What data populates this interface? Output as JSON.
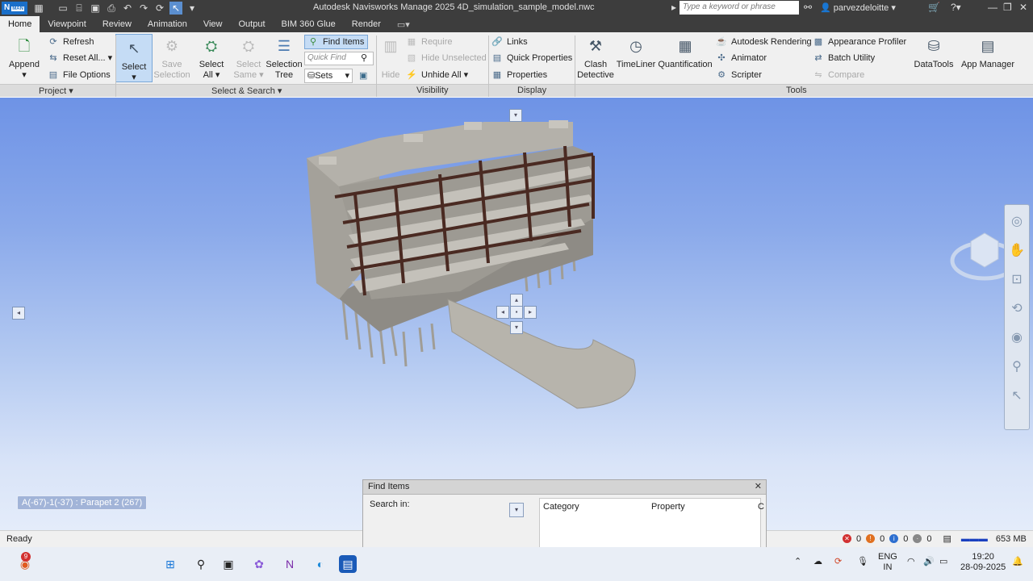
{
  "titlebar": {
    "logo": "N",
    "logo_sub": "MAN",
    "app_title": "Autodesk Navisworks Manage 2025     4D_simulation_sample_model.nwc",
    "search_placeholder": "Type a keyword or phrase",
    "user": "parvezdeloitte"
  },
  "tabs": [
    "Home",
    "Viewpoint",
    "Review",
    "Animation",
    "View",
    "Output",
    "BIM 360 Glue",
    "Render"
  ],
  "ribbon": {
    "append": "Append",
    "refresh": "Refresh",
    "reset_all": "Reset All...",
    "file_options": "File Options",
    "select": "Select",
    "save_selection_1": "Save",
    "save_selection_2": "Selection",
    "select_all_1": "Select",
    "select_all_2": "All",
    "select_same_1": "Select",
    "select_same_2": "Same",
    "selection_tree_1": "Selection",
    "selection_tree_2": "Tree",
    "find_items": "Find Items",
    "quick_find": "Quick Find",
    "sets": "Sets",
    "hide": "Hide",
    "require": "Require",
    "hide_unselected": "Hide Unselected",
    "unhide_all": "Unhide All",
    "links": "Links",
    "quick_properties": "Quick Properties",
    "properties": "Properties",
    "clash_detective_1": "Clash",
    "clash_detective_2": "Detective",
    "timeliner": "TimeLiner",
    "quantification": "Quantification",
    "autodesk_rendering": "Autodesk Rendering",
    "animator": "Animator",
    "scripter": "Scripter",
    "appearance_profiler": "Appearance Profiler",
    "batch_utility": "Batch Utility",
    "compare": "Compare",
    "datatools": "DataTools",
    "app_manager": "App Manager"
  },
  "panels": {
    "project": "Project",
    "select_search": "Select & Search",
    "visibility": "Visibility",
    "display": "Display",
    "tools": "Tools"
  },
  "viewport": {
    "tooltip": "A(-67)-1(-37) : Parapet 2 (267)"
  },
  "find_dialog": {
    "title": "Find Items",
    "search_in": "Search in:",
    "columns": [
      "Category",
      "Property",
      "C"
    ]
  },
  "statusbar": {
    "ready": "Ready",
    "errors": "0",
    "warnings": "0",
    "info": "0",
    "other": "0",
    "memory": "653 MB"
  },
  "taskbar": {
    "notification_badge": "9",
    "lang_1": "ENG",
    "lang_2": "IN",
    "time": "19:20",
    "date": "28-09-2025"
  },
  "colors": {
    "ribbon_bg": "#f0f0f0",
    "titlebar_bg": "#3d3d3d",
    "accent": "#c5dcf5",
    "sky_top": "#6e93e6",
    "sky_bottom": "#e4ecfa",
    "model_gray": "#8c8a84",
    "beam_brown": "#4a2a22"
  }
}
